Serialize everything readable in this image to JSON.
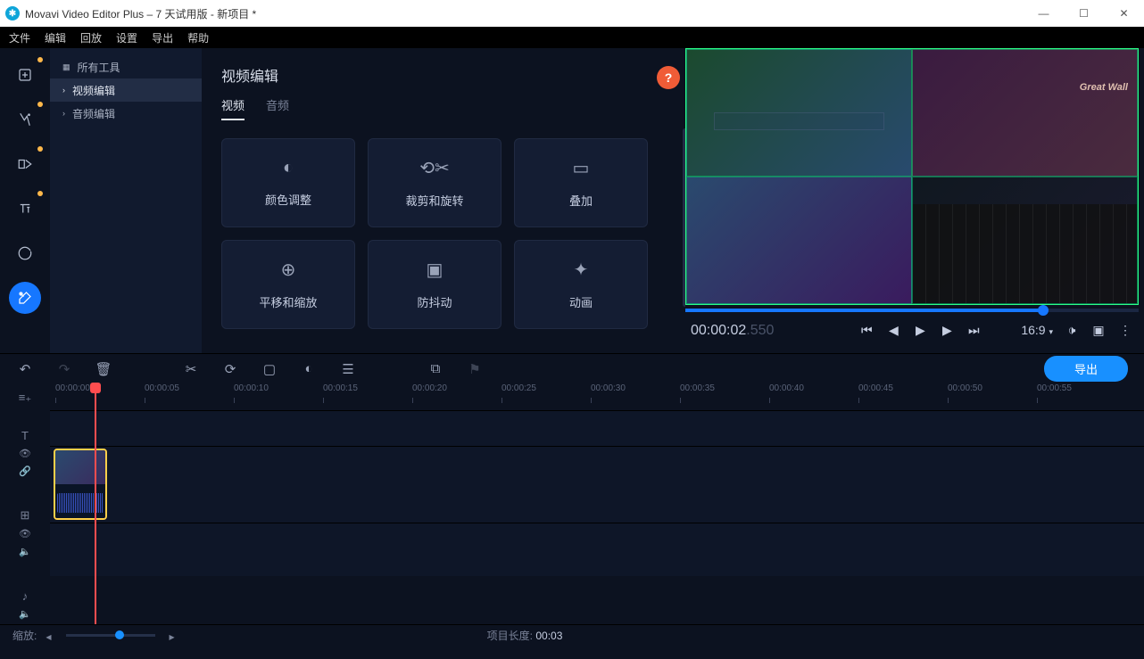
{
  "window": {
    "title": "Movavi Video Editor Plus – 7 天试用版 - 新项目 *"
  },
  "menu": [
    "文件",
    "编辑",
    "回放",
    "设置",
    "导出",
    "帮助"
  ],
  "sidebar": {
    "allTools": "所有工具",
    "videoEdit": "视频编辑",
    "audioEdit": "音频编辑"
  },
  "panel": {
    "title": "视频编辑",
    "tabs": {
      "video": "视频",
      "audio": "音频"
    },
    "cards": {
      "color": "颜色调整",
      "crop": "裁剪和旋转",
      "overlay": "叠加",
      "panzoom": "平移和缩放",
      "stabilize": "防抖动",
      "animate": "动画"
    },
    "help": "?"
  },
  "preview": {
    "brand": "Great Wall",
    "time": "00:00:02",
    "time_ms": ".550",
    "ratio": "16:9"
  },
  "toolbar": {
    "export": "导出"
  },
  "ruler": [
    "00:00:00",
    "00:00:05",
    "00:00:10",
    "00:00:15",
    "00:00:20",
    "00:00:25",
    "00:00:30",
    "00:00:35",
    "00:00:40",
    "00:00:45",
    "00:00:50",
    "00:00:55"
  ],
  "status": {
    "zoomLabel": "缩放:",
    "projLenLabel": "项目长度:",
    "projLen": "00:03"
  }
}
